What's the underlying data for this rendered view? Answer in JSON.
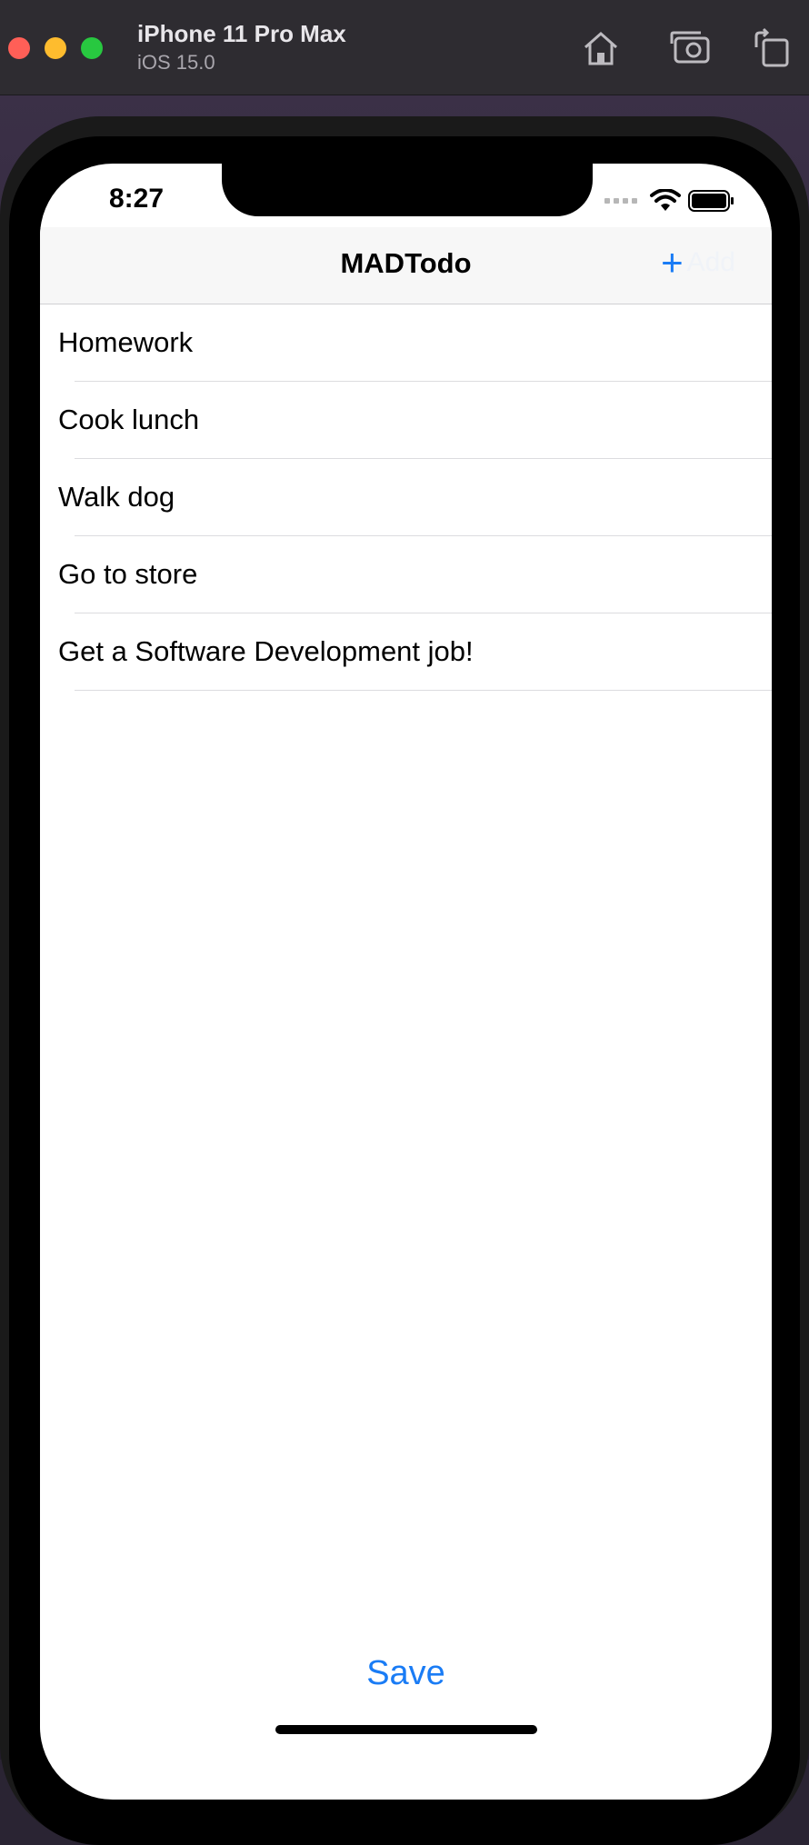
{
  "simulator": {
    "device_name": "iPhone 11 Pro Max",
    "os_version": "iOS 15.0",
    "toolbar_icons": [
      "home-icon",
      "screenshot-icon",
      "rotate-icon"
    ]
  },
  "status_bar": {
    "time": "8:27",
    "icons": [
      "cellular-signal-icon",
      "wifi-icon",
      "battery-icon"
    ]
  },
  "navbar": {
    "title": "MADTodo",
    "add_label": "Add",
    "add_icon": "plus-icon"
  },
  "todos": [
    {
      "label": "Homework"
    },
    {
      "label": "Cook lunch"
    },
    {
      "label": "Walk dog"
    },
    {
      "label": "Go to store"
    },
    {
      "label": "Get a Software Development job!"
    }
  ],
  "footer": {
    "save_label": "Save"
  },
  "colors": {
    "accent": "#1a7cf5",
    "traffic_red": "#ff5f57",
    "traffic_yellow": "#febc2e",
    "traffic_green": "#28c840"
  }
}
